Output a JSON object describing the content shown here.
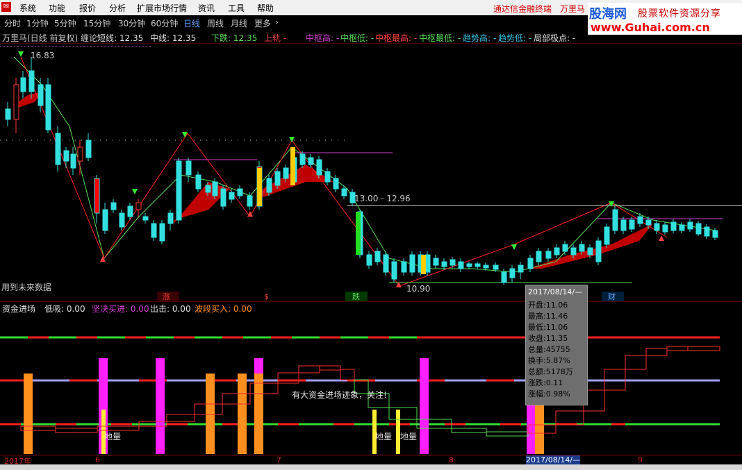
{
  "menu": {
    "items": [
      "系统",
      "功能",
      "报价",
      "分析",
      "扩展市场行情",
      "资讯",
      "工具",
      "帮助"
    ],
    "links": [
      "通达信金融终端",
      "万里马"
    ]
  },
  "brand": {
    "logo": "股海网",
    "tagline": "股票软件资源分享",
    "url": "www.Guhai.com.cn"
  },
  "periods": {
    "items": [
      "分时",
      "1分钟",
      "5分钟",
      "15分钟",
      "30分钟",
      "60分钟",
      "日线",
      "周线",
      "月线",
      "更多",
      "›"
    ],
    "active": "日线"
  },
  "info": {
    "title": "万里马(日线 前复权) 缠论",
    "short_line": "短线: 12.35",
    "mid_line": "中线: 12.35",
    "down": "下跌: 12.35",
    "up": "上轨 -",
    "zhong_high": "中枢高: -",
    "zhong_low": "中枢低: -",
    "zhong_top": "中枢最高: -",
    "zhong_bottom": "中枢最低: -",
    "trend_high": "趋势高: -",
    "trend_low": "趋势低: -",
    "extreme": "局部极点: -"
  },
  "price_chart": {
    "high_label": "16.83",
    "low_label": "10.90",
    "range_label": "13.00 - 12.96",
    "future_note": "用到未来数据",
    "signals": [
      "涨",
      "$",
      "跌",
      "财"
    ],
    "colors": {
      "up": "#ff3b3b",
      "down": "#33e0e0",
      "ma": "#c00000",
      "stroke": "#ff2020",
      "green": "#55dd55",
      "magenta": "#d040d0"
    }
  },
  "indicator": {
    "name": "资金进场",
    "low_buy": "低吸: 0.00",
    "firm_buy": "坚决买进: 0.00",
    "exit": "出击: 0.00",
    "wave_buy": "波段买入: 0.00",
    "annotation": "有大资金进场迹象，关注!",
    "bar_labels": [
      "地量",
      "地量",
      "地量"
    ]
  },
  "tooltip": {
    "date": "2017/08/14/—",
    "rows": [
      {
        "k": "开盘",
        "v": "11.06"
      },
      {
        "k": "最高",
        "v": "11.46"
      },
      {
        "k": "最低",
        "v": "11.06"
      },
      {
        "k": "收盘",
        "v": "11.35"
      },
      {
        "k": "总量",
        "v": "45755"
      },
      {
        "k": "换手",
        "v": "5.87%"
      },
      {
        "k": "总额",
        "v": "5178万"
      },
      {
        "k": "涨跌",
        "v": "0.11"
      },
      {
        "k": "涨幅",
        "v": "0.98%"
      }
    ]
  },
  "time_axis": [
    "2017年",
    "6",
    "7",
    "8",
    "2017/08/14/—",
    "9"
  ]
}
